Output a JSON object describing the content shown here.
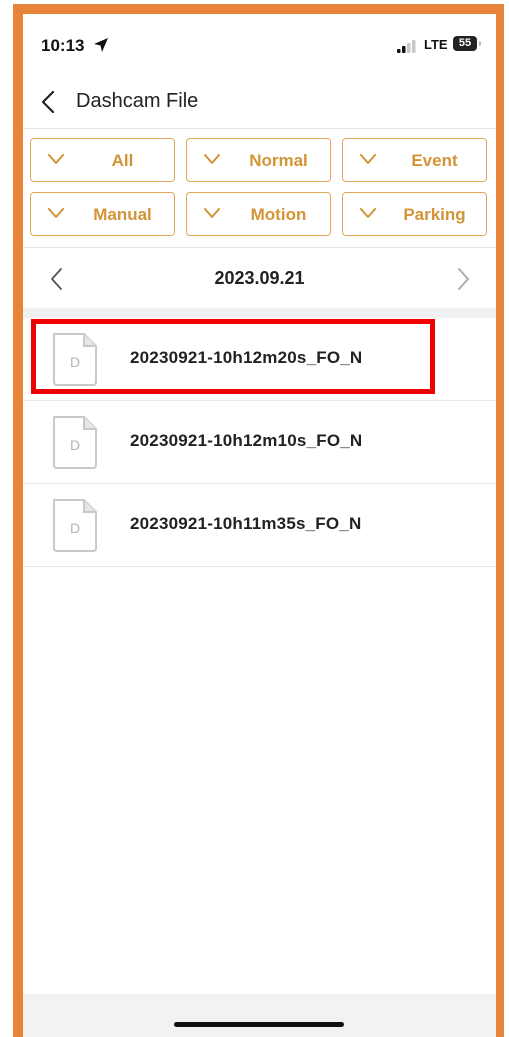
{
  "status_bar": {
    "time": "10:13",
    "network": "LTE",
    "battery": "55",
    "location_icon": "location-arrow-icon",
    "signal_icon": "signal-bars-icon"
  },
  "header": {
    "title": "Dashcam File",
    "back_icon": "chevron-left-icon"
  },
  "filters": [
    {
      "label": "All",
      "checked": true
    },
    {
      "label": "Normal",
      "checked": true
    },
    {
      "label": "Event",
      "checked": true
    },
    {
      "label": "Manual",
      "checked": true
    },
    {
      "label": "Motion",
      "checked": true
    },
    {
      "label": "Parking",
      "checked": true
    }
  ],
  "date_nav": {
    "date": "2023.09.21",
    "prev_icon": "chevron-left-icon",
    "next_icon": "chevron-right-icon"
  },
  "files": [
    {
      "icon_letter": "D",
      "name": "20230921-10h12m20s_FO_N",
      "highlighted": true
    },
    {
      "icon_letter": "D",
      "name": "20230921-10h12m10s_FO_N",
      "highlighted": false
    },
    {
      "icon_letter": "D",
      "name": "20230921-10h11m35s_FO_N",
      "highlighted": false
    }
  ],
  "colors": {
    "accent": "#d39436",
    "chip_border": "#e2a85a",
    "frame": "#e8843a",
    "highlight": "#f00000"
  }
}
